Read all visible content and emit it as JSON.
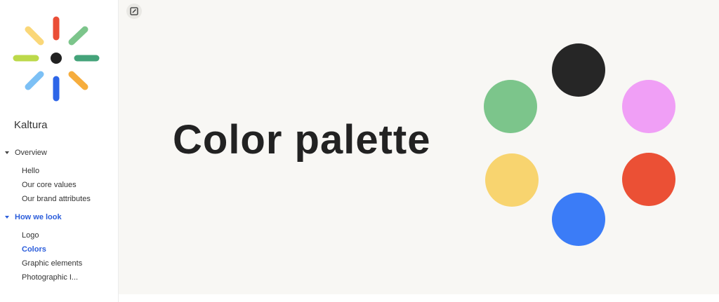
{
  "sidebar": {
    "brand_name": "Kaltura",
    "sections": [
      {
        "label": "Overview",
        "active": false,
        "items": [
          {
            "label": "Hello"
          },
          {
            "label": "Our core values"
          },
          {
            "label": "Our brand attributes"
          }
        ]
      },
      {
        "label": "How we look",
        "active": true,
        "items": [
          {
            "label": "Logo"
          },
          {
            "label": "Colors"
          },
          {
            "label": "Graphic elements"
          },
          {
            "label": "Photographic I..."
          }
        ]
      }
    ]
  },
  "main": {
    "title": "Color palette",
    "edit_icon": "edit-square-icon"
  },
  "colors": {
    "accent_blue": "#2b5ddb",
    "palette": [
      "#262626",
      "#f09ff6",
      "#eb5035",
      "#3b7cf7",
      "#f8d46f",
      "#7cc58b"
    ]
  }
}
